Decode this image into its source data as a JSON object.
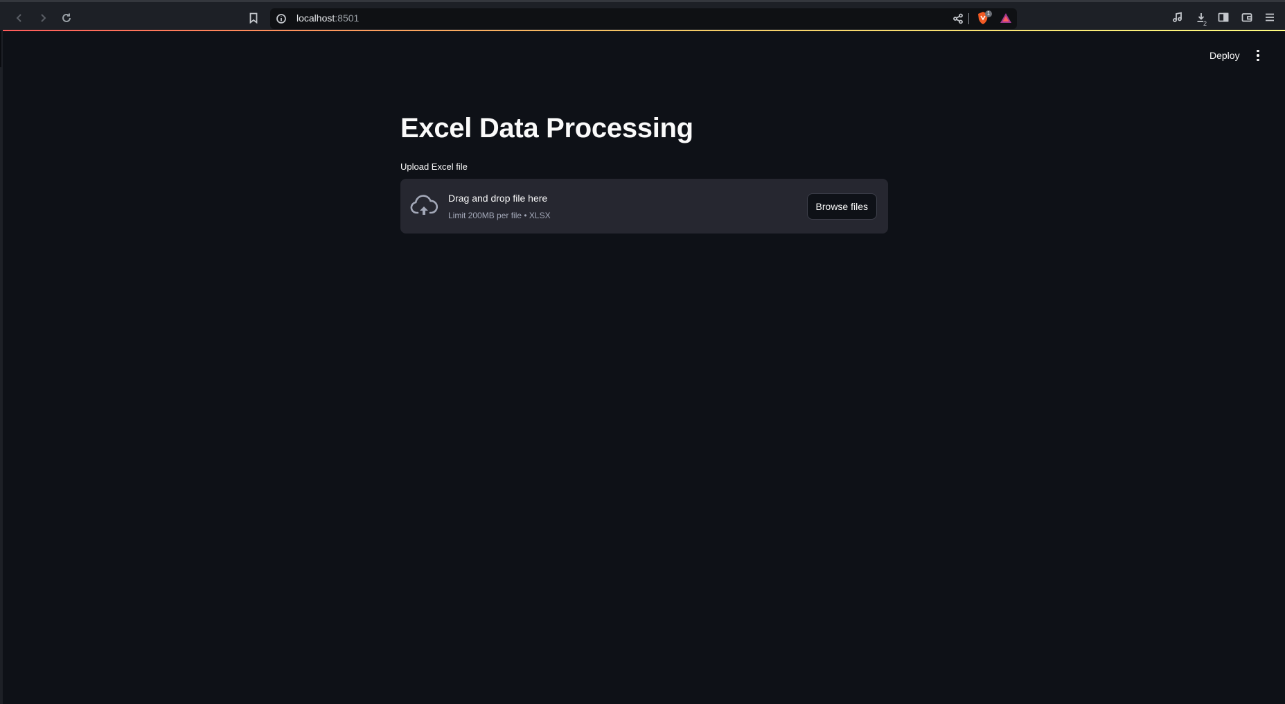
{
  "browser": {
    "url_host": "localhost",
    "url_port": ":8501",
    "shields_badge": "1",
    "downloads_count": "2",
    "icons": [
      "back-icon",
      "forward-icon",
      "reload-icon",
      "bookmark-icon",
      "site-info-icon",
      "share-icon",
      "brave-shields-icon",
      "brave-rewards-icon",
      "media-icon",
      "downloads-icon",
      "sidebar-icon",
      "wallet-icon",
      "menu-icon"
    ]
  },
  "toolbar": {
    "deploy_label": "Deploy",
    "menu_icon": "kebab-menu-icon"
  },
  "page": {
    "title": "Excel Data Processing"
  },
  "uploader": {
    "label": "Upload Excel file",
    "drop_title": "Drag and drop file here",
    "drop_hint": "Limit 200MB per file • XLSX",
    "browse_label": "Browse files",
    "icon": "cloud-upload-icon"
  },
  "colors": {
    "background": "#0e1117",
    "dropzone": "#262730",
    "text": "#fafafa",
    "muted": "#a3a8b8"
  }
}
